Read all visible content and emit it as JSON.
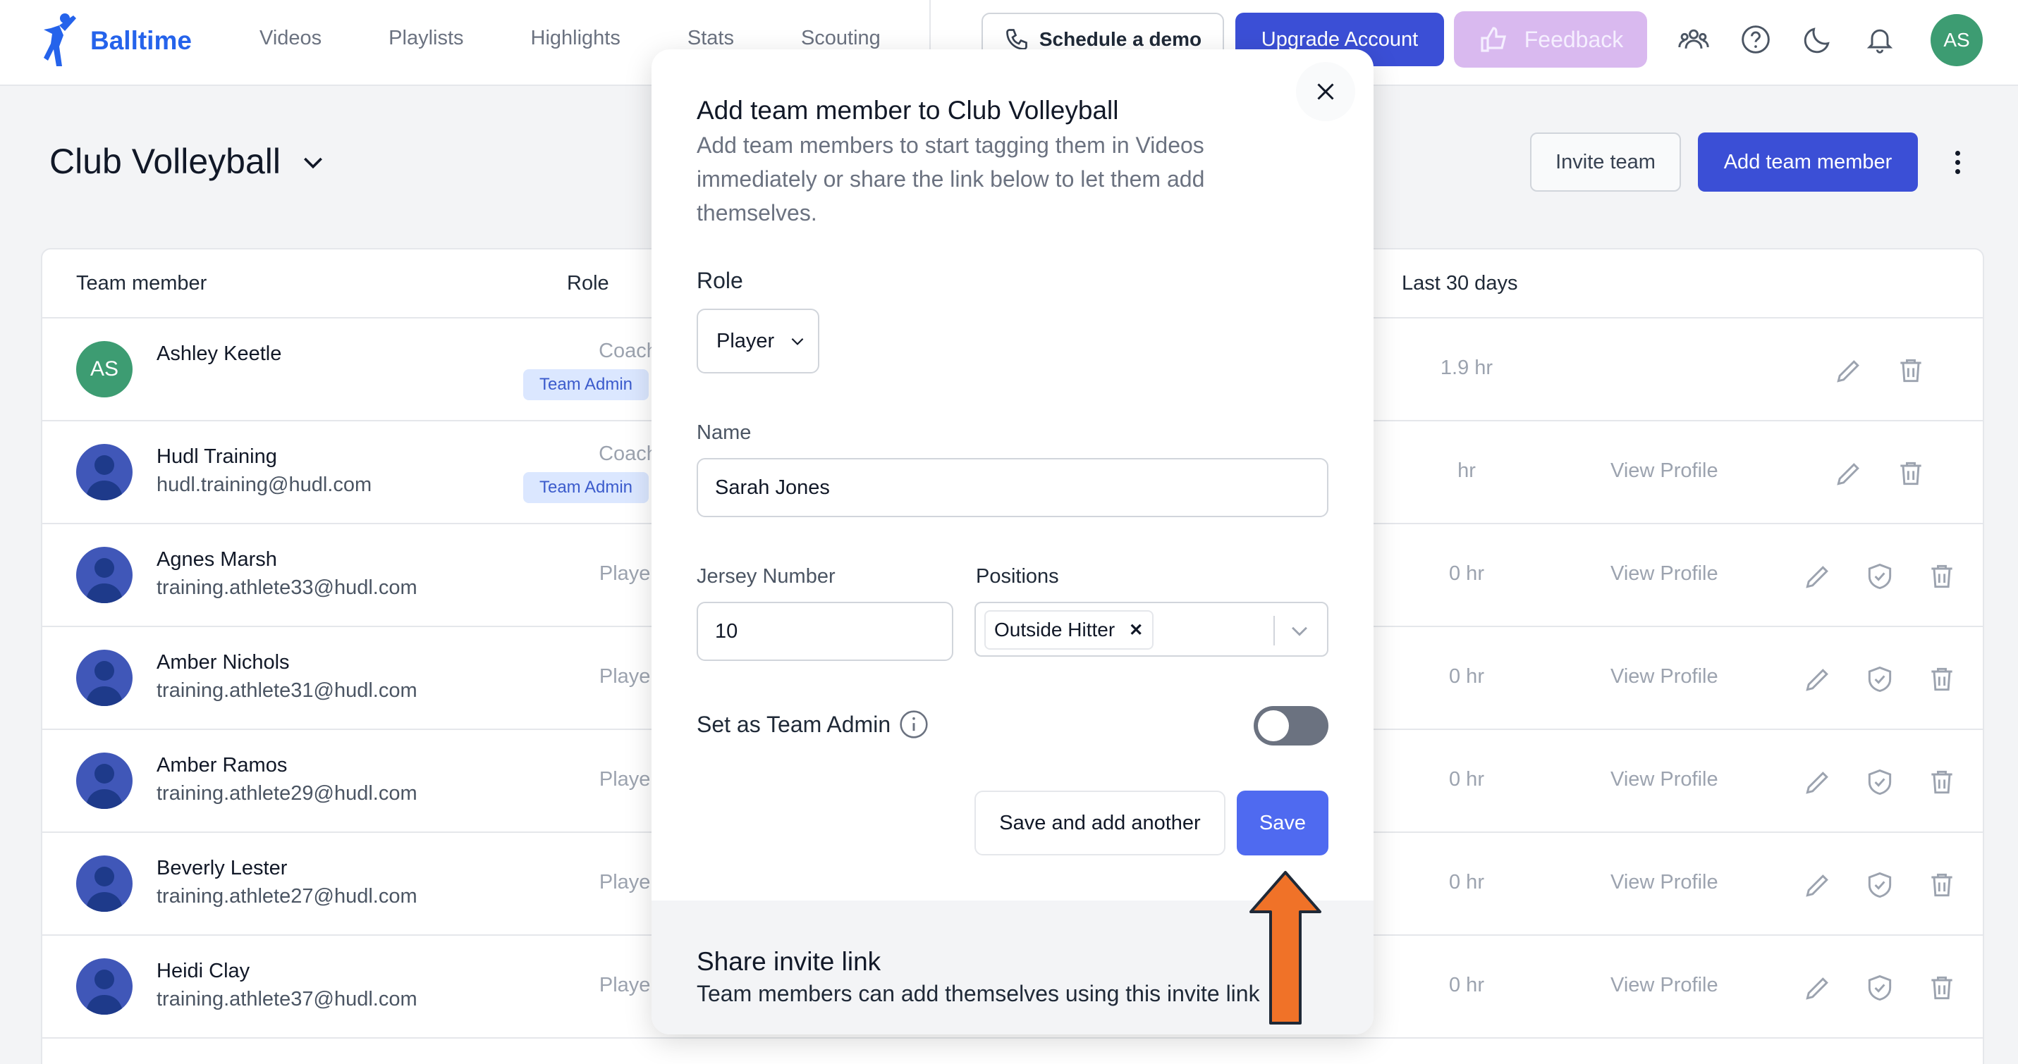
{
  "app": {
    "name": "Balltime"
  },
  "nav": {
    "items": [
      "Videos",
      "Playlists",
      "Highlights",
      "Stats",
      "Scouting"
    ]
  },
  "top_actions": {
    "schedule_demo": "Schedule a demo",
    "upgrade": "Upgrade Account",
    "feedback": "Feedback",
    "user_initials": "AS"
  },
  "page": {
    "team_name": "Club Volleyball",
    "invite_team": "Invite team",
    "add_team_member": "Add team member"
  },
  "table": {
    "headers": {
      "member": "Team member",
      "role": "Role",
      "last30": "Last 30 days"
    },
    "rows": [
      {
        "initials": "AS",
        "name": "Ashley Keetle",
        "email": "",
        "role": "Coach",
        "badge": "Team Admin",
        "hours": "1.9 hr",
        "profile": ""
      },
      {
        "initials": "",
        "name": "Hudl Training",
        "email": "hudl.training@hudl.com",
        "role": "Coach",
        "badge": "Team Admin",
        "hours": "hr",
        "profile": "View Profile"
      },
      {
        "initials": "",
        "name": "Agnes Marsh",
        "email": "training.athlete33@hudl.com",
        "role": "Player",
        "badge": "",
        "hours": "0 hr",
        "profile": "View Profile"
      },
      {
        "initials": "",
        "name": "Amber Nichols",
        "email": "training.athlete31@hudl.com",
        "role": "Player",
        "badge": "",
        "hours": "0 hr",
        "profile": "View Profile"
      },
      {
        "initials": "",
        "name": "Amber Ramos",
        "email": "training.athlete29@hudl.com",
        "role": "Player",
        "badge": "",
        "hours": "0 hr",
        "profile": "View Profile"
      },
      {
        "initials": "",
        "name": "Beverly Lester",
        "email": "training.athlete27@hudl.com",
        "role": "Player",
        "badge": "",
        "hours": "0 hr",
        "profile": "View Profile"
      },
      {
        "initials": "",
        "name": "Heidi Clay",
        "email": "training.athlete37@hudl.com",
        "role": "Player",
        "badge": "",
        "hours": "0 hr",
        "profile": "View Profile"
      }
    ]
  },
  "modal": {
    "title": "Add team member to Club Volleyball",
    "description": "Add team members to start tagging them in Videos immediately or share the link below to let them add themselves.",
    "role_label": "Role",
    "role_value": "Player",
    "name_label": "Name",
    "name_value": "Sarah Jones",
    "jersey_label": "Jersey Number",
    "jersey_value": "10",
    "positions_label": "Positions",
    "positions_selected": [
      "Outside Hitter"
    ],
    "admin_label": "Set as Team Admin",
    "admin_enabled": false,
    "save_another": "Save and add another",
    "save": "Save",
    "share_title": "Share invite link",
    "share_desc": "Team members can add themselves using this invite link"
  },
  "colors": {
    "brand": "#2563eb",
    "primary_button": "#3b4fd6",
    "save_button": "#4f6af0",
    "feedback_button": "#d9b9ef",
    "avatar_green": "#3d9c72",
    "annotation_arrow": "#f07228"
  },
  "icons": {
    "logo": "volleyball-player-icon",
    "phone": "phone-icon",
    "feedback": "thumbs-icon",
    "team": "team-icon",
    "help": "help-circle-icon",
    "theme": "moon-icon",
    "notifications": "bell-icon",
    "edit": "pencil-icon",
    "delete": "trash-icon",
    "admin": "shield-check-icon"
  }
}
